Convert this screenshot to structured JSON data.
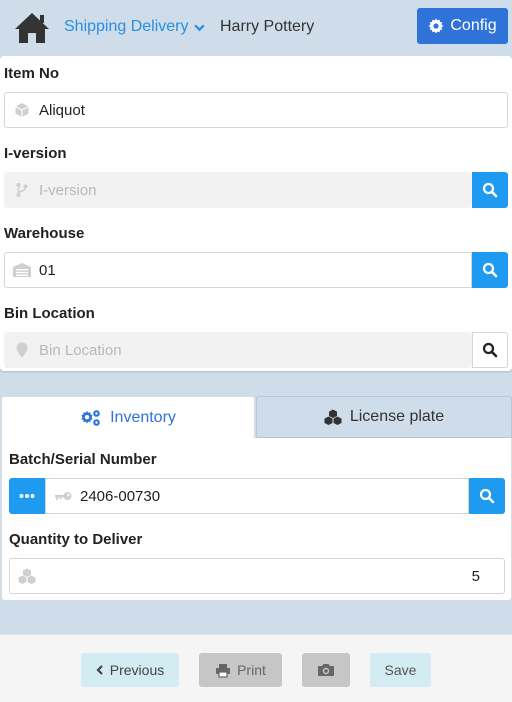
{
  "header": {
    "module": "Shipping Delivery",
    "user": "Harry Pottery",
    "config_label": "Config"
  },
  "form": {
    "item_no": {
      "label": "Item No",
      "value": "Aliquot"
    },
    "i_version": {
      "label": "I-version",
      "placeholder": "I-version"
    },
    "warehouse": {
      "label": "Warehouse",
      "value": "01"
    },
    "bin_location": {
      "label": "Bin Location",
      "placeholder": "Bin Location"
    }
  },
  "tabs": [
    {
      "label": "Inventory",
      "active": true
    },
    {
      "label": "License plate",
      "active": false
    }
  ],
  "inventory": {
    "batch": {
      "label": "Batch/Serial Number",
      "value": "2406-00730"
    },
    "quantity": {
      "label": "Quantity to Deliver",
      "value": "5"
    }
  },
  "footer": {
    "previous_label": "Previous",
    "print_label": "Print",
    "save_label": "Save"
  },
  "colors": {
    "accent": "#1e9af0",
    "config": "#2f72d8",
    "background": "#cfdce9"
  }
}
